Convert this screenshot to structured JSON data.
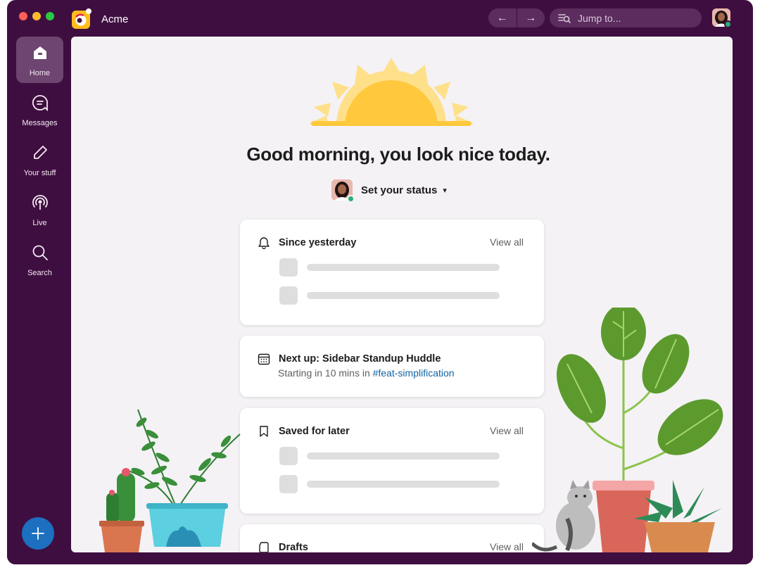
{
  "app": {
    "workspace_name": "Acme"
  },
  "toolbar": {
    "back_icon": "←",
    "forward_icon": "→",
    "search_placeholder": "Jump to..."
  },
  "rail": {
    "items": [
      {
        "label": "Home",
        "icon": "home-icon"
      },
      {
        "label": "Messages",
        "icon": "messages-icon"
      },
      {
        "label": "Your stuff",
        "icon": "pencil-icon"
      },
      {
        "label": "Live",
        "icon": "broadcast-icon"
      },
      {
        "label": "Search",
        "icon": "search-icon"
      }
    ],
    "compose_label": "+"
  },
  "main": {
    "greeting": "Good morning, you look nice today.",
    "status_label": "Set your status",
    "cards": [
      {
        "title": "Since yesterday",
        "action": "View all",
        "icon": "bell-icon"
      },
      {
        "title": "Next up: Sidebar Standup Huddle",
        "subtitle_prefix": "Starting in 10 mins in ",
        "channel": "#feat-simplification",
        "icon": "calendar-icon"
      },
      {
        "title": "Saved for later",
        "action": "View all",
        "icon": "bookmark-icon"
      },
      {
        "title": "Drafts",
        "action": "View all",
        "icon": "draft-icon"
      }
    ]
  },
  "colors": {
    "sidebar": "#3f0e40",
    "accent": "#1264a3",
    "online": "#2bac76",
    "compose": "#1d6fbf"
  }
}
